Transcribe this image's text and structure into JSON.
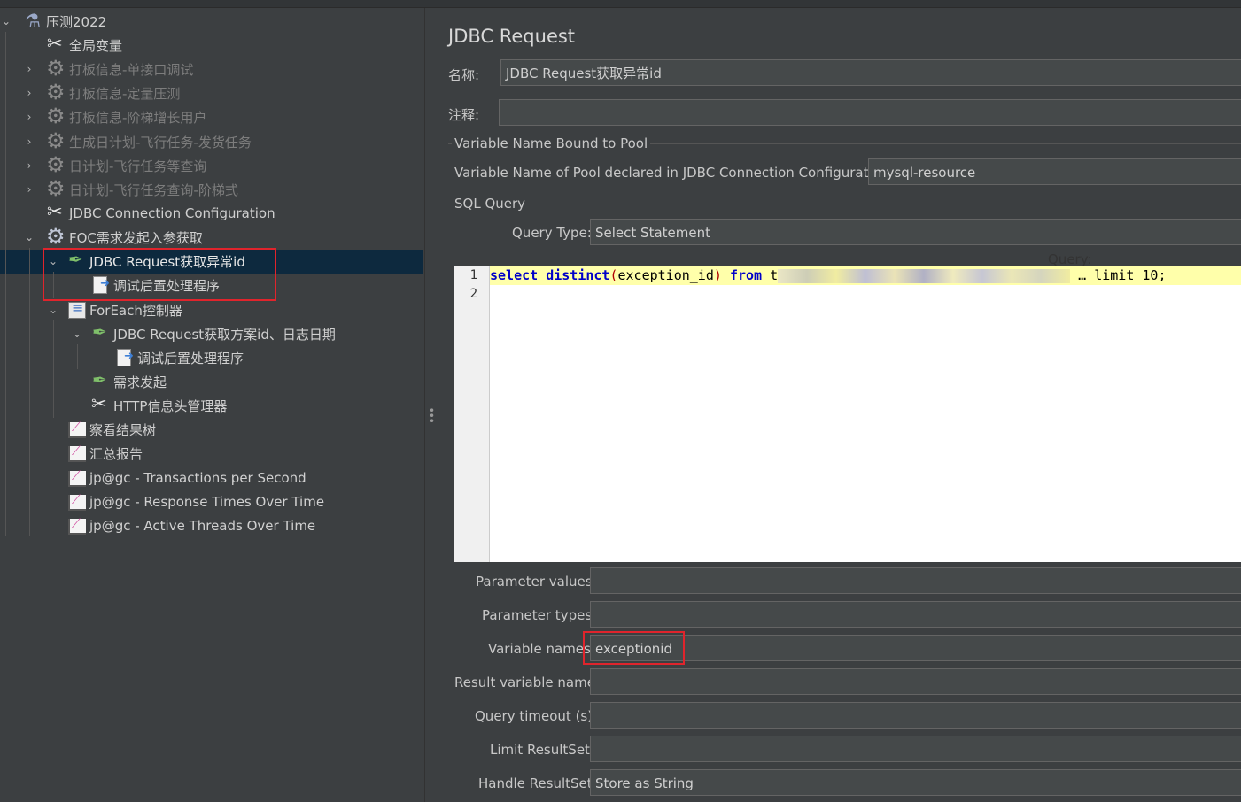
{
  "tree": {
    "items": [
      {
        "label": "压测2022",
        "icon": "flask-icon",
        "arrow": "⌄"
      },
      {
        "label": "全局变量",
        "icon": "tools-icon",
        "arrow": ""
      },
      {
        "label": "打板信息-单接口调试",
        "icon": "gear-icon",
        "arrow": "›"
      },
      {
        "label": "打板信息-定量压测",
        "icon": "gear-icon",
        "arrow": "›"
      },
      {
        "label": "打板信息-阶梯增长用户",
        "icon": "gear-icon",
        "arrow": "›"
      },
      {
        "label": "生成日计划-飞行任务-发货任务",
        "icon": "gear-icon",
        "arrow": "›"
      },
      {
        "label": "日计划-飞行任务等查询",
        "icon": "gear-icon",
        "arrow": "›"
      },
      {
        "label": "日计划-飞行任务查询-阶梯式",
        "icon": "gear-icon",
        "arrow": "›"
      },
      {
        "label": "JDBC Connection Configuration",
        "icon": "tools-icon",
        "arrow": ""
      },
      {
        "label": "FOC需求发起入参获取",
        "icon": "gear-icon",
        "arrow": "⌄"
      },
      {
        "label": "JDBC Request获取异常id",
        "icon": "sampler-icon",
        "arrow": "⌄"
      },
      {
        "label": "调试后置处理程序",
        "icon": "postprocessor-icon",
        "arrow": ""
      },
      {
        "label": "ForEach控制器",
        "icon": "foreach-icon",
        "arrow": "⌄"
      },
      {
        "label": "JDBC Request获取方案id、日志日期",
        "icon": "sampler-icon",
        "arrow": "⌄"
      },
      {
        "label": "调试后置处理程序",
        "icon": "postprocessor-icon",
        "arrow": ""
      },
      {
        "label": "需求发起",
        "icon": "sampler-icon",
        "arrow": ""
      },
      {
        "label": "HTTP信息头管理器",
        "icon": "tools-icon",
        "arrow": ""
      },
      {
        "label": "察看结果树",
        "icon": "graph-icon",
        "arrow": ""
      },
      {
        "label": "汇总报告",
        "icon": "graph-icon",
        "arrow": ""
      },
      {
        "label": "jp@gc - Transactions per Second",
        "icon": "graph-icon",
        "arrow": ""
      },
      {
        "label": "jp@gc - Response Times Over Time",
        "icon": "graph-icon",
        "arrow": ""
      },
      {
        "label": "jp@gc - Active Threads Over Time",
        "icon": "graph-icon",
        "arrow": ""
      }
    ]
  },
  "panel": {
    "title": "JDBC Request",
    "name_label": "名称:",
    "name_value": "JDBC Request获取异常id",
    "comment_label": "注释:",
    "comment_value": "",
    "pool_section": "Variable Name Bound to Pool",
    "pool_label": "Variable Name of Pool declared in JDBC Connection Configuration:",
    "pool_value": "mysql-resource",
    "sql_section": "SQL Query",
    "query_type_label": "Query Type:",
    "query_type_value": "Select Statement",
    "query_label": "Query:",
    "code": {
      "line1": "1",
      "line2": "2",
      "kw_select": "select",
      "kw_distinct": "distinct",
      "open": "(",
      "column": "exception_id",
      "close": ")",
      "kw_from": "from",
      "table_start": "t",
      "tail": "… limit 10;"
    },
    "param_values_label": "Parameter values:",
    "param_values_value": "",
    "param_types_label": "Parameter types:",
    "param_types_value": "",
    "var_names_label": "Variable names:",
    "var_names_value": "exceptionid",
    "result_var_label": "Result variable name:",
    "result_var_value": "",
    "timeout_label": "Query timeout (s):",
    "timeout_value": "",
    "limit_label": "Limit ResultSet:",
    "limit_value": "",
    "handle_label": "Handle ResultSet:",
    "handle_value": "Store as String"
  }
}
